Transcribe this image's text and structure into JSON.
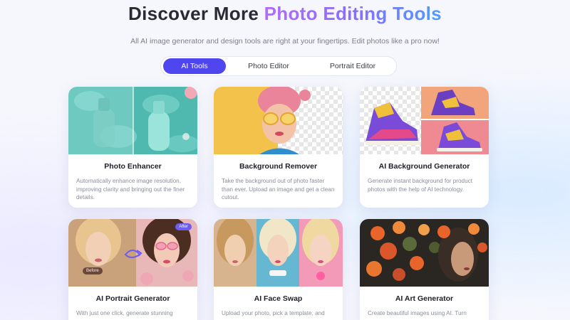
{
  "header": {
    "title_plain": "Discover More ",
    "title_highlight": "Photo Editing Tools",
    "subtitle": "All AI image generator and design tools are right at your fingertips. Edit photos like a pro now!"
  },
  "tabs": [
    {
      "label": "AI Tools",
      "active": true
    },
    {
      "label": "Photo Editor",
      "active": false
    },
    {
      "label": "Portrait Editor",
      "active": false
    }
  ],
  "cards": [
    {
      "title": "Photo Enhancer",
      "desc": "Automatically enhance image resolution, improving clarity and bringing out the finer details."
    },
    {
      "title": "Background Remover",
      "desc": "Take the background out of photo faster than ever. Upload an image and get a clean cutout."
    },
    {
      "title": "AI Background Generator",
      "desc": "Generate instant background for product photos with the help of AI technology."
    },
    {
      "title": "AI Portrait Generator",
      "desc": "With just one click, generate stunning",
      "badge_before": "Before",
      "badge_after": "After"
    },
    {
      "title": "AI Face Swap",
      "desc": "Upload your photo, pick a template, and"
    },
    {
      "title": "AI Art Generator",
      "desc": "Create beautiful images using AI. Turn"
    }
  ],
  "colors": {
    "accent": "#4f46f0",
    "title_gradient_start": "#b16cff",
    "title_gradient_end": "#4d9cff"
  }
}
